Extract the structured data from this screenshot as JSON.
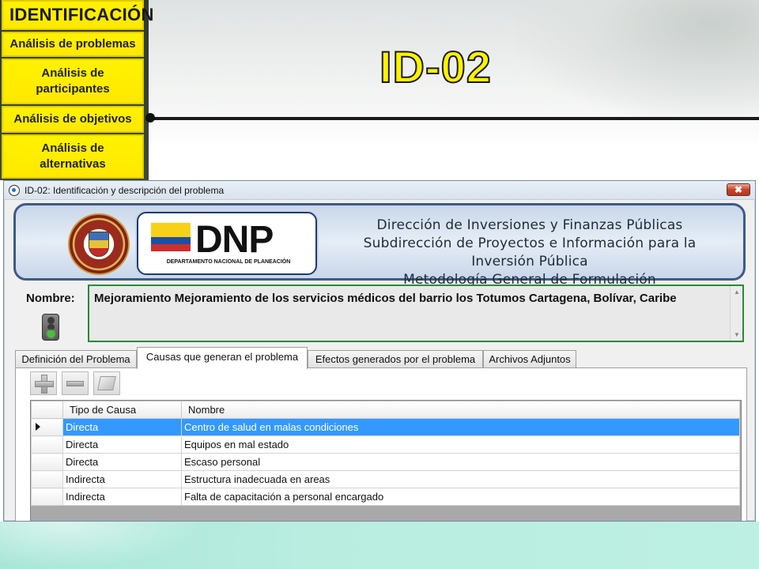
{
  "slide": {
    "title": "ID-02"
  },
  "nav": {
    "items": [
      {
        "label": "IDENTIFICACIÓN"
      },
      {
        "label": "Análisis de problemas"
      },
      {
        "label": "Análisis de participantes"
      },
      {
        "label": "Análisis de objetivos"
      },
      {
        "label": "Análisis de alternativas"
      }
    ]
  },
  "window": {
    "title": "ID-02: Identificación y descripción del problema",
    "close_label": "✖"
  },
  "banner": {
    "dnp_logo_text": "DNP",
    "dnp_logo_subtitle": "DEPARTAMENTO NACIONAL DE PLANEACIÓN",
    "crest_text": "REPÚBLICA DE COLOMBIA",
    "lines": [
      "Dirección de Inversiones y Finanzas Públicas",
      "Subdirección de Proyectos e Información para la Inversión Pública",
      "Metodología General de Formulación"
    ]
  },
  "project": {
    "name_label": "Nombre:",
    "name_value": "Mejoramiento Mejoramiento de los servicios médicos del barrio los Totumos Cartagena, Bolívar, Caribe"
  },
  "tabs": [
    {
      "label": "Definición del Problema"
    },
    {
      "label": "Causas que generan el problema",
      "active": true
    },
    {
      "label": "Efectos generados por el problema"
    },
    {
      "label": "Archivos Adjuntos"
    }
  ],
  "toolbar": {
    "add_icon": "plus-icon",
    "remove_icon": "minus-icon",
    "edit_icon": "edit-icon"
  },
  "grid": {
    "columns": [
      "Tipo de Causa",
      "Nombre"
    ],
    "rows": [
      {
        "tipo": "Directa",
        "nombre": "Centro de salud en malas condiciones",
        "selected": true
      },
      {
        "tipo": "Directa",
        "nombre": "Equipos en mal estado"
      },
      {
        "tipo": "Directa",
        "nombre": "Escaso personal"
      },
      {
        "tipo": "Indirecta",
        "nombre": "Estructura inadecuada en areas"
      },
      {
        "tipo": "Indirecta",
        "nombre": "Falta de capacitación a personal encargado"
      }
    ]
  },
  "colors": {
    "nav_yellow": "#fff200",
    "selection_blue": "#3399ff",
    "name_border_green": "#2a8a3a",
    "bottom_teal": "#b8ede0"
  }
}
